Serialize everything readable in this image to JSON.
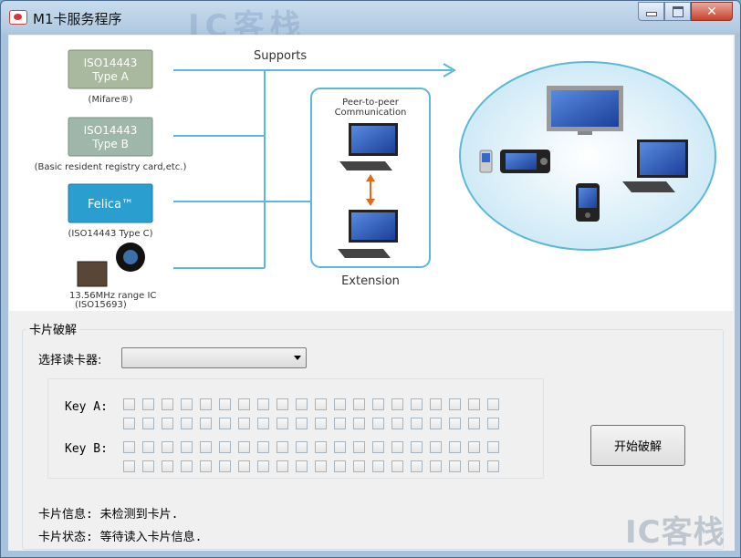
{
  "window": {
    "title": "M1卡服务程序",
    "watermark_top": "IC客栈"
  },
  "banner": {
    "supports": "Supports",
    "iso_a": [
      "ISO14443",
      "Type A"
    ],
    "mifare": "(Mifare®)",
    "iso_b": [
      "ISO14443",
      "Type B"
    ],
    "basic": "(Basic resident registry card,etc.)",
    "felica": "Felica™",
    "iso_c": "(ISO14443 Type C)",
    "range_ic": "13.56MHz range IC",
    "iso15693": "(ISO15693)",
    "p2p": [
      "Peer-to-peer",
      "Communication"
    ],
    "extension": "Extension"
  },
  "card_crack": {
    "legend": "卡片破解",
    "reader_label": "选择读卡器:",
    "reader_value": "",
    "key_a_label": "Key A:",
    "key_b_label": "Key B:",
    "key_checkboxes_per_row": 20,
    "start_button": "开始破解"
  },
  "status": {
    "info": "卡片信息: 未检测到卡片.",
    "state": "卡片状态: 等待读入卡片信息."
  },
  "watermark": "IC客栈",
  "colors": {
    "line": "#5bb8d6",
    "blue_card": "#2a9fcf",
    "gray_card": "#9fb2a3",
    "cloud": "#d7eef8"
  }
}
